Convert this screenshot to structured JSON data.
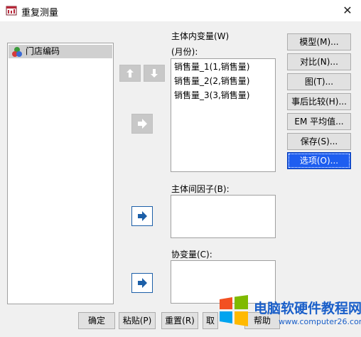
{
  "window": {
    "title": "重复测量"
  },
  "source_list": {
    "items": [
      "门店编码"
    ]
  },
  "within_vars": {
    "label": "主体内变量(W)",
    "sublabel": "(月份):",
    "items": [
      "销售量_1(1,销售量)",
      "销售量_2(2,销售量)",
      "销售量_3(3,销售量)"
    ]
  },
  "between_factors": {
    "label": "主体间因子(B):"
  },
  "covariates": {
    "label": "协变量(C):"
  },
  "side_buttons": {
    "model": "模型(M)...",
    "contrast": "对比(N)...",
    "plots": "图(T)...",
    "posthoc": "事后比较(H)...",
    "em_means": "EM 平均值...",
    "save": "保存(S)...",
    "options": "选项(O)..."
  },
  "bottom_buttons": {
    "ok": "确定",
    "paste": "粘贴(P)",
    "reset": "重置(R)",
    "cancel": "取",
    "help": "帮助"
  },
  "watermark": {
    "title": "电脑软硬件教程网",
    "url": "www.computer26.com"
  },
  "colors": {
    "selected_button": "#1e5ef0",
    "arrow_blue": "#1c5fa8",
    "watermark": "#1a5fc9"
  }
}
